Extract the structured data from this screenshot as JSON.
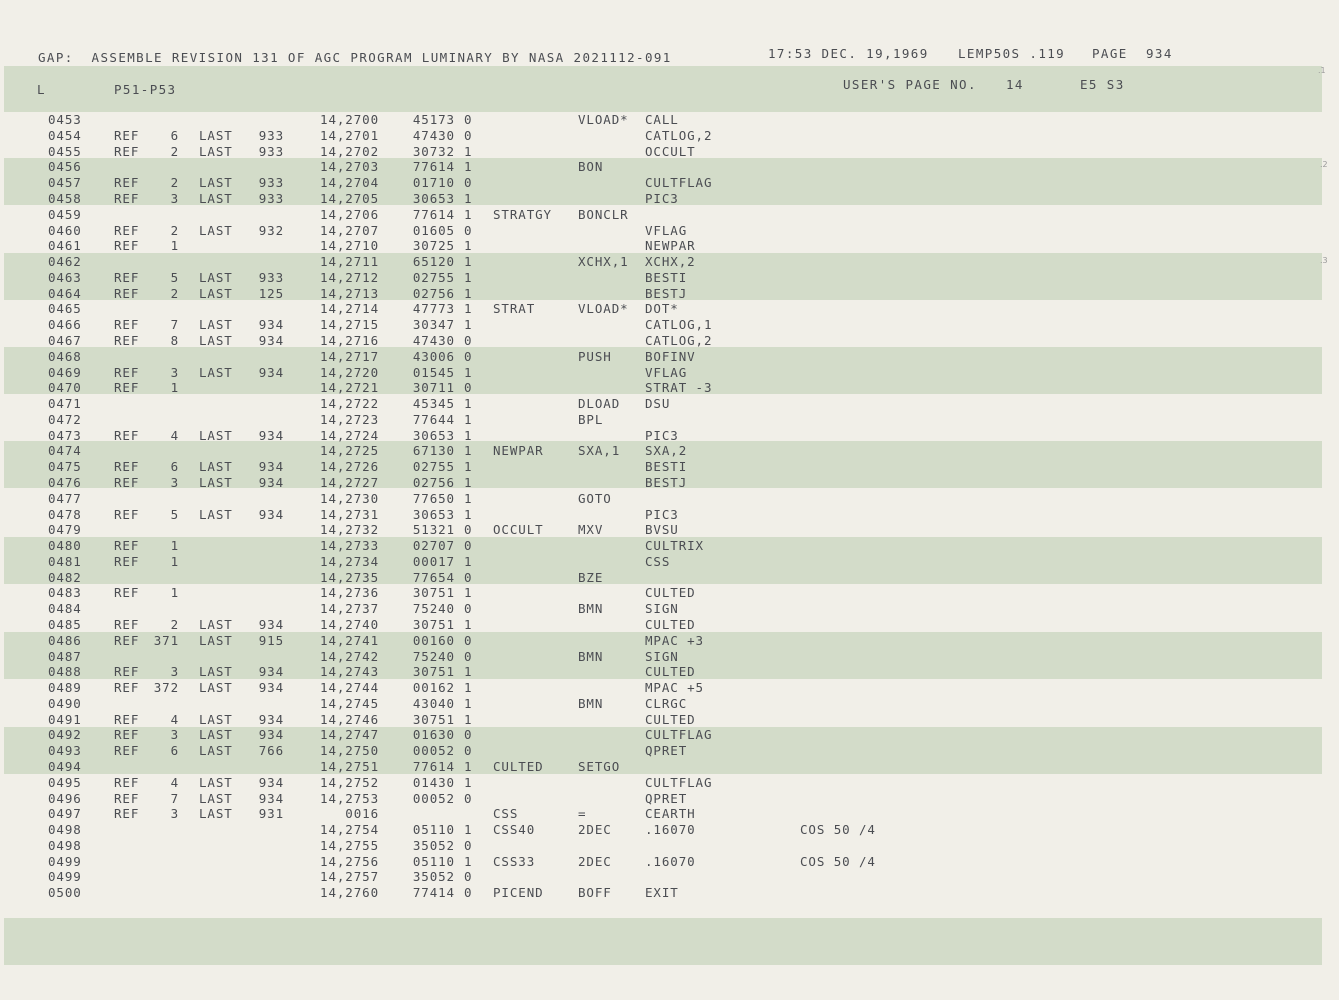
{
  "header": {
    "title": "GAP:  ASSEMBLE REVISION 131 OF AGC PROGRAM LUMINARY BY NASA 2021112-091",
    "timestamp": "17:53 DEC. 19,1969",
    "job": "LEMP50S .119",
    "page_label": "PAGE",
    "page_number": "934"
  },
  "subheader": {
    "left": "L",
    "section": "P51-P53",
    "users_page_label": "USER'S PAGE NO.",
    "users_page_number": "14",
    "code": "E5 S3"
  },
  "margin_marks": [
    ".1",
    ".2",
    ".3"
  ],
  "rows": [
    {
      "line": "0453",
      "ref": "",
      "rn": "",
      "last": "",
      "lp": "",
      "addr": "14,2700",
      "word": "45173",
      "par": "0",
      "label": "",
      "op": "VLOAD*",
      "operand": "CALL",
      "comment": ""
    },
    {
      "line": "0454",
      "ref": "REF",
      "rn": "6",
      "last": "LAST",
      "lp": "933",
      "addr": "14,2701",
      "word": "47430",
      "par": "0",
      "label": "",
      "op": "",
      "operand": "CATLOG,2",
      "comment": ""
    },
    {
      "line": "0455",
      "ref": "REF",
      "rn": "2",
      "last": "LAST",
      "lp": "933",
      "addr": "14,2702",
      "word": "30732",
      "par": "1",
      "label": "",
      "op": "",
      "operand": "OCCULT",
      "comment": ""
    },
    {
      "line": "0456",
      "ref": "",
      "rn": "",
      "last": "",
      "lp": "",
      "addr": "14,2703",
      "word": "77614",
      "par": "1",
      "label": "",
      "op": "BON",
      "operand": "",
      "comment": ""
    },
    {
      "line": "0457",
      "ref": "REF",
      "rn": "2",
      "last": "LAST",
      "lp": "933",
      "addr": "14,2704",
      "word": "01710",
      "par": "0",
      "label": "",
      "op": "",
      "operand": "CULTFLAG",
      "comment": ""
    },
    {
      "line": "0458",
      "ref": "REF",
      "rn": "3",
      "last": "LAST",
      "lp": "933",
      "addr": "14,2705",
      "word": "30653",
      "par": "1",
      "label": "",
      "op": "",
      "operand": "PIC3",
      "comment": ""
    },
    {
      "line": "0459",
      "ref": "",
      "rn": "",
      "last": "",
      "lp": "",
      "addr": "14,2706",
      "word": "77614",
      "par": "1",
      "label": "STRATGY",
      "op": "BONCLR",
      "operand": "",
      "comment": ""
    },
    {
      "line": "0460",
      "ref": "REF",
      "rn": "2",
      "last": "LAST",
      "lp": "932",
      "addr": "14,2707",
      "word": "01605",
      "par": "0",
      "label": "",
      "op": "",
      "operand": "VFLAG",
      "comment": ""
    },
    {
      "line": "0461",
      "ref": "REF",
      "rn": "1",
      "last": "",
      "lp": "",
      "addr": "14,2710",
      "word": "30725",
      "par": "1",
      "label": "",
      "op": "",
      "operand": "NEWPAR",
      "comment": ""
    },
    {
      "line": "0462",
      "ref": "",
      "rn": "",
      "last": "",
      "lp": "",
      "addr": "14,2711",
      "word": "65120",
      "par": "1",
      "label": "",
      "op": "XCHX,1",
      "operand": "XCHX,2",
      "comment": ""
    },
    {
      "line": "0463",
      "ref": "REF",
      "rn": "5",
      "last": "LAST",
      "lp": "933",
      "addr": "14,2712",
      "word": "02755",
      "par": "1",
      "label": "",
      "op": "",
      "operand": "BESTI",
      "comment": ""
    },
    {
      "line": "0464",
      "ref": "REF",
      "rn": "2",
      "last": "LAST",
      "lp": "125",
      "addr": "14,2713",
      "word": "02756",
      "par": "1",
      "label": "",
      "op": "",
      "operand": "BESTJ",
      "comment": ""
    },
    {
      "line": "0465",
      "ref": "",
      "rn": "",
      "last": "",
      "lp": "",
      "addr": "14,2714",
      "word": "47773",
      "par": "1",
      "label": "STRAT",
      "op": "VLOAD*",
      "operand": "DOT*",
      "comment": ""
    },
    {
      "line": "0466",
      "ref": "REF",
      "rn": "7",
      "last": "LAST",
      "lp": "934",
      "addr": "14,2715",
      "word": "30347",
      "par": "1",
      "label": "",
      "op": "",
      "operand": "CATLOG,1",
      "comment": ""
    },
    {
      "line": "0467",
      "ref": "REF",
      "rn": "8",
      "last": "LAST",
      "lp": "934",
      "addr": "14,2716",
      "word": "47430",
      "par": "0",
      "label": "",
      "op": "",
      "operand": "CATLOG,2",
      "comment": ""
    },
    {
      "line": "0468",
      "ref": "",
      "rn": "",
      "last": "",
      "lp": "",
      "addr": "14,2717",
      "word": "43006",
      "par": "0",
      "label": "",
      "op": "PUSH",
      "operand": "BOFINV",
      "comment": ""
    },
    {
      "line": "0469",
      "ref": "REF",
      "rn": "3",
      "last": "LAST",
      "lp": "934",
      "addr": "14,2720",
      "word": "01545",
      "par": "1",
      "label": "",
      "op": "",
      "operand": "VFLAG",
      "comment": ""
    },
    {
      "line": "0470",
      "ref": "REF",
      "rn": "1",
      "last": "",
      "lp": "",
      "addr": "14,2721",
      "word": "30711",
      "par": "0",
      "label": "",
      "op": "",
      "operand": "STRAT -3",
      "comment": ""
    },
    {
      "line": "0471",
      "ref": "",
      "rn": "",
      "last": "",
      "lp": "",
      "addr": "14,2722",
      "word": "45345",
      "par": "1",
      "label": "",
      "op": "DLOAD",
      "operand": "DSU",
      "comment": ""
    },
    {
      "line": "0472",
      "ref": "",
      "rn": "",
      "last": "",
      "lp": "",
      "addr": "14,2723",
      "word": "77644",
      "par": "1",
      "label": "",
      "op": "BPL",
      "operand": "",
      "comment": ""
    },
    {
      "line": "0473",
      "ref": "REF",
      "rn": "4",
      "last": "LAST",
      "lp": "934",
      "addr": "14,2724",
      "word": "30653",
      "par": "1",
      "label": "",
      "op": "",
      "operand": "PIC3",
      "comment": ""
    },
    {
      "line": "0474",
      "ref": "",
      "rn": "",
      "last": "",
      "lp": "",
      "addr": "14,2725",
      "word": "67130",
      "par": "1",
      "label": "NEWPAR",
      "op": "SXA,1",
      "operand": "SXA,2",
      "comment": ""
    },
    {
      "line": "0475",
      "ref": "REF",
      "rn": "6",
      "last": "LAST",
      "lp": "934",
      "addr": "14,2726",
      "word": "02755",
      "par": "1",
      "label": "",
      "op": "",
      "operand": "BESTI",
      "comment": ""
    },
    {
      "line": "0476",
      "ref": "REF",
      "rn": "3",
      "last": "LAST",
      "lp": "934",
      "addr": "14,2727",
      "word": "02756",
      "par": "1",
      "label": "",
      "op": "",
      "operand": "BESTJ",
      "comment": ""
    },
    {
      "line": "0477",
      "ref": "",
      "rn": "",
      "last": "",
      "lp": "",
      "addr": "14,2730",
      "word": "77650",
      "par": "1",
      "label": "",
      "op": "GOTO",
      "operand": "",
      "comment": ""
    },
    {
      "line": "0478",
      "ref": "REF",
      "rn": "5",
      "last": "LAST",
      "lp": "934",
      "addr": "14,2731",
      "word": "30653",
      "par": "1",
      "label": "",
      "op": "",
      "operand": "PIC3",
      "comment": ""
    },
    {
      "line": "0479",
      "ref": "",
      "rn": "",
      "last": "",
      "lp": "",
      "addr": "14,2732",
      "word": "51321",
      "par": "0",
      "label": "OCCULT",
      "op": "MXV",
      "operand": "BVSU",
      "comment": ""
    },
    {
      "line": "0480",
      "ref": "REF",
      "rn": "1",
      "last": "",
      "lp": "",
      "addr": "14,2733",
      "word": "02707",
      "par": "0",
      "label": "",
      "op": "",
      "operand": "CULTRIX",
      "comment": ""
    },
    {
      "line": "0481",
      "ref": "REF",
      "rn": "1",
      "last": "",
      "lp": "",
      "addr": "14,2734",
      "word": "00017",
      "par": "1",
      "label": "",
      "op": "",
      "operand": "CSS",
      "comment": ""
    },
    {
      "line": "0482",
      "ref": "",
      "rn": "",
      "last": "",
      "lp": "",
      "addr": "14,2735",
      "word": "77654",
      "par": "0",
      "label": "",
      "op": "BZE",
      "operand": "",
      "comment": ""
    },
    {
      "line": "0483",
      "ref": "REF",
      "rn": "1",
      "last": "",
      "lp": "",
      "addr": "14,2736",
      "word": "30751",
      "par": "1",
      "label": "",
      "op": "",
      "operand": "CULTED",
      "comment": ""
    },
    {
      "line": "0484",
      "ref": "",
      "rn": "",
      "last": "",
      "lp": "",
      "addr": "14,2737",
      "word": "75240",
      "par": "0",
      "label": "",
      "op": "BMN",
      "operand": "SIGN",
      "comment": ""
    },
    {
      "line": "0485",
      "ref": "REF",
      "rn": "2",
      "last": "LAST",
      "lp": "934",
      "addr": "14,2740",
      "word": "30751",
      "par": "1",
      "label": "",
      "op": "",
      "operand": "CULTED",
      "comment": ""
    },
    {
      "line": "0486",
      "ref": "REF",
      "rn": "371",
      "last": "LAST",
      "lp": "915",
      "addr": "14,2741",
      "word": "00160",
      "par": "0",
      "label": "",
      "op": "",
      "operand": "MPAC +3",
      "comment": ""
    },
    {
      "line": "0487",
      "ref": "",
      "rn": "",
      "last": "",
      "lp": "",
      "addr": "14,2742",
      "word": "75240",
      "par": "0",
      "label": "",
      "op": "BMN",
      "operand": "SIGN",
      "comment": ""
    },
    {
      "line": "0488",
      "ref": "REF",
      "rn": "3",
      "last": "LAST",
      "lp": "934",
      "addr": "14,2743",
      "word": "30751",
      "par": "1",
      "label": "",
      "op": "",
      "operand": "CULTED",
      "comment": ""
    },
    {
      "line": "0489",
      "ref": "REF",
      "rn": "372",
      "last": "LAST",
      "lp": "934",
      "addr": "14,2744",
      "word": "00162",
      "par": "1",
      "label": "",
      "op": "",
      "operand": "MPAC +5",
      "comment": ""
    },
    {
      "line": "0490",
      "ref": "",
      "rn": "",
      "last": "",
      "lp": "",
      "addr": "14,2745",
      "word": "43040",
      "par": "1",
      "label": "",
      "op": "BMN",
      "operand": "CLRGC",
      "comment": ""
    },
    {
      "line": "0491",
      "ref": "REF",
      "rn": "4",
      "last": "LAST",
      "lp": "934",
      "addr": "14,2746",
      "word": "30751",
      "par": "1",
      "label": "",
      "op": "",
      "operand": "CULTED",
      "comment": ""
    },
    {
      "line": "0492",
      "ref": "REF",
      "rn": "3",
      "last": "LAST",
      "lp": "934",
      "addr": "14,2747",
      "word": "01630",
      "par": "0",
      "label": "",
      "op": "",
      "operand": "CULTFLAG",
      "comment": ""
    },
    {
      "line": "0493",
      "ref": "REF",
      "rn": "6",
      "last": "LAST",
      "lp": "766",
      "addr": "14,2750",
      "word": "00052",
      "par": "0",
      "label": "",
      "op": "",
      "operand": "QPRET",
      "comment": ""
    },
    {
      "line": "0494",
      "ref": "",
      "rn": "",
      "last": "",
      "lp": "",
      "addr": "14,2751",
      "word": "77614",
      "par": "1",
      "label": "CULTED",
      "op": "SETGO",
      "operand": "",
      "comment": ""
    },
    {
      "line": "0495",
      "ref": "REF",
      "rn": "4",
      "last": "LAST",
      "lp": "934",
      "addr": "14,2752",
      "word": "01430",
      "par": "1",
      "label": "",
      "op": "",
      "operand": "CULTFLAG",
      "comment": ""
    },
    {
      "line": "0496",
      "ref": "REF",
      "rn": "7",
      "last": "LAST",
      "lp": "934",
      "addr": "14,2753",
      "word": "00052",
      "par": "0",
      "label": "",
      "op": "",
      "operand": "QPRET",
      "comment": ""
    },
    {
      "line": "0497",
      "ref": "REF",
      "rn": "3",
      "last": "LAST",
      "lp": "931",
      "addr": "0016",
      "word": "",
      "par": "",
      "label": "CSS",
      "op": "=",
      "operand": "CEARTH",
      "comment": ""
    },
    {
      "line": "0498",
      "ref": "",
      "rn": "",
      "last": "",
      "lp": "",
      "addr": "14,2754",
      "word": "05110",
      "par": "1",
      "label": "CSS40",
      "op": "2DEC",
      "operand": ".16070",
      "comment": "COS 50 /4"
    },
    {
      "line": "0498",
      "ref": "",
      "rn": "",
      "last": "",
      "lp": "",
      "addr": "14,2755",
      "word": "35052",
      "par": "0",
      "label": "",
      "op": "",
      "operand": "",
      "comment": ""
    },
    {
      "line": "0499",
      "ref": "",
      "rn": "",
      "last": "",
      "lp": "",
      "addr": "14,2756",
      "word": "05110",
      "par": "1",
      "label": "CSS33",
      "op": "2DEC",
      "operand": ".16070",
      "comment": "COS 50 /4"
    },
    {
      "line": "0499",
      "ref": "",
      "rn": "",
      "last": "",
      "lp": "",
      "addr": "14,2757",
      "word": "35052",
      "par": "0",
      "label": "",
      "op": "",
      "operand": "",
      "comment": ""
    },
    {
      "line": "0500",
      "ref": "",
      "rn": "",
      "last": "",
      "lp": "",
      "addr": "14,2760",
      "word": "77414",
      "par": "0",
      "label": "PICEND",
      "op": "BOFF",
      "operand": "EXIT",
      "comment": ""
    }
  ]
}
